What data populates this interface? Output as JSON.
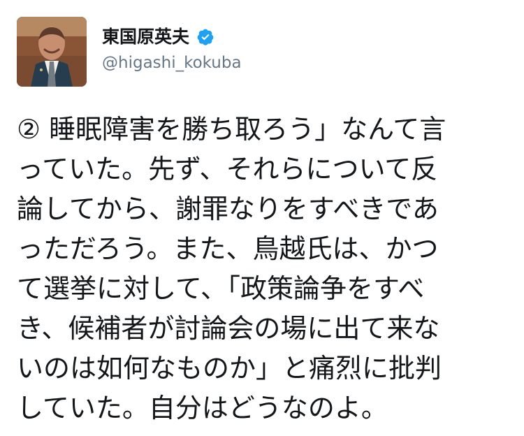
{
  "tweet": {
    "author": {
      "display_name": "東国原英夫",
      "handle": "@higashi_kokuba",
      "verified_icon": "verified-badge-icon",
      "avatar_icon": "profile-avatar"
    },
    "text_lines": [
      "② 睡眠障害を勝ち取ろう」なんて言",
      "っていた。先ず、それらについて反",
      "論してから、謝罪なりをすべきであ",
      "っただろう。また、鳥越氏は、かつ",
      "て選挙に対して、「政策論争をすべ",
      "き、候補者が討論会の場に出て来な",
      "いのは如何なものか」と痛烈に批判",
      "していた。自分はどうなのよ。"
    ]
  },
  "colors": {
    "background": "#ffffff",
    "text": "#14171a",
    "secondary_text": "#657786",
    "verified": "#1da1f2"
  }
}
